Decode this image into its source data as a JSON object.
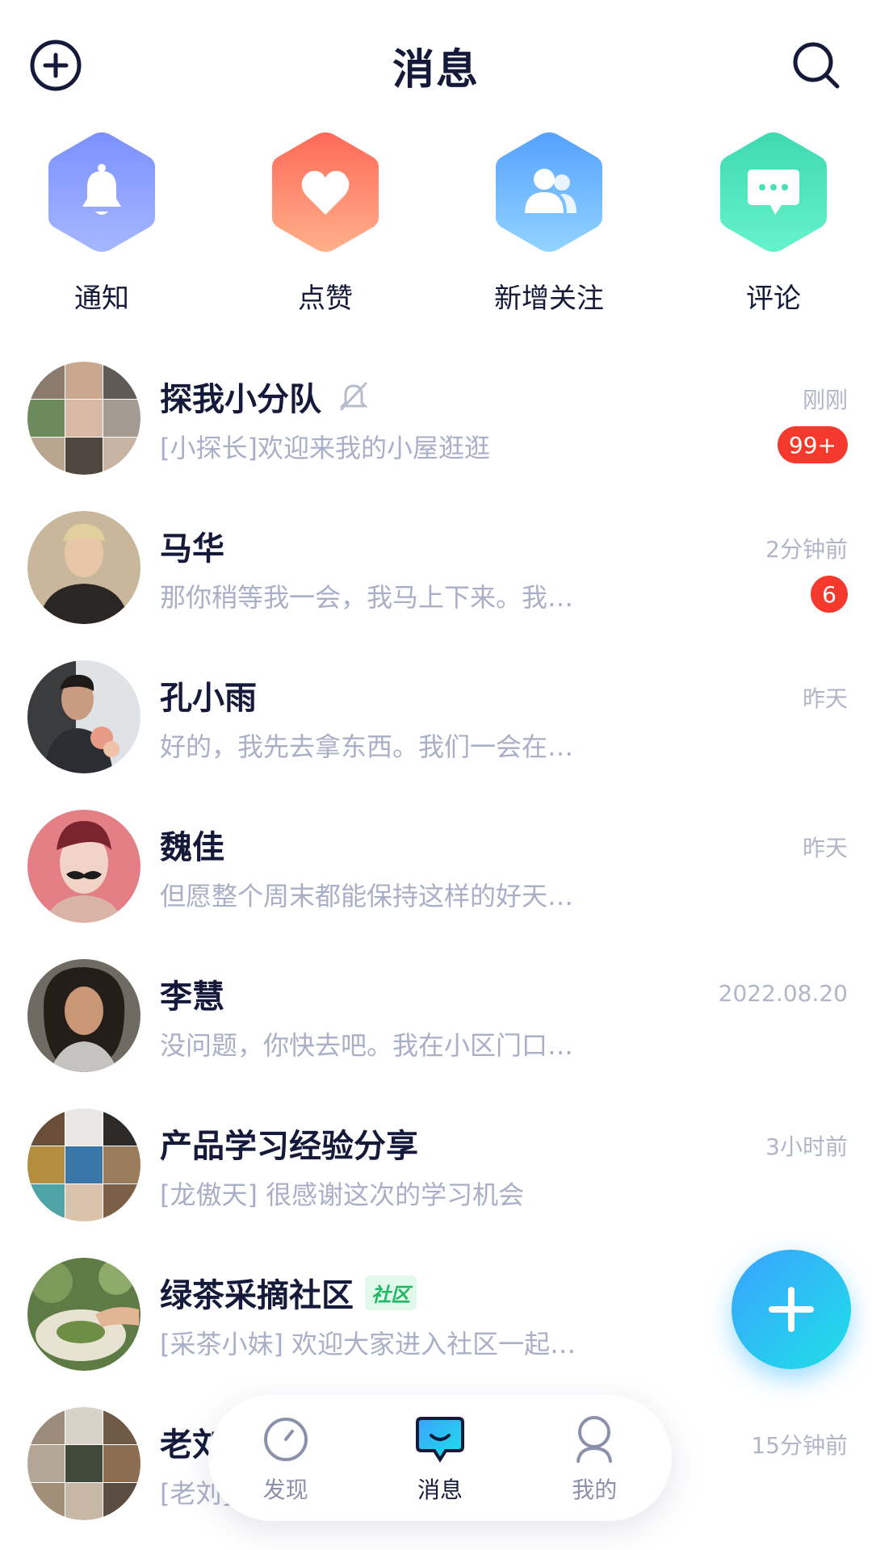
{
  "header": {
    "title": "消息",
    "add_icon": "plus-circle-icon",
    "search_icon": "search-icon"
  },
  "shortcuts": [
    {
      "label": "通知",
      "icon": "bell-icon",
      "colors": [
        "#7c90ff",
        "#9db2ff"
      ]
    },
    {
      "label": "点赞",
      "icon": "heart-icon",
      "colors": [
        "#ff6f5b",
        "#ffa981"
      ]
    },
    {
      "label": "新增关注",
      "icon": "users-icon",
      "colors": [
        "#5aa6ff",
        "#8fd0ff"
      ]
    },
    {
      "label": "评论",
      "icon": "comment-icon",
      "colors": [
        "#3fe0b5",
        "#62f0c9"
      ]
    }
  ],
  "conversations": [
    {
      "name": "探我小分队",
      "preview": "[小探长]欢迎来我的小屋逛逛",
      "time": "刚刚",
      "badge": "99+",
      "muted": true
    },
    {
      "name": "马华",
      "preview": "那你稍等我一会，我马上下来。我…",
      "time": "2分钟前",
      "badge": "6"
    },
    {
      "name": "孔小雨",
      "preview": "好的，我先去拿东西。我们一会在…",
      "time": "昨天"
    },
    {
      "name": "魏佳",
      "preview": "但愿整个周末都能保持这样的好天…",
      "time": "昨天"
    },
    {
      "name": "李慧",
      "preview": "没问题，你快去吧。我在小区门口…",
      "time": "2022.08.20"
    },
    {
      "name": "产品学习经验分享",
      "preview": "[龙傲天] 很感谢这次的学习机会",
      "time": "3小时前"
    },
    {
      "name": "绿茶采摘社区",
      "tag": "社区",
      "preview": "[采茶小妹] 欢迎大家进入社区一起…",
      "time": ""
    },
    {
      "name": "老刘",
      "preview": "[老刘]",
      "time": "15分钟前"
    }
  ],
  "tabbar": {
    "tabs": [
      {
        "label": "发现",
        "icon": "compass-icon"
      },
      {
        "label": "消息",
        "icon": "chat-icon",
        "active": true
      },
      {
        "label": "我的",
        "icon": "person-icon"
      }
    ]
  },
  "fab": {
    "icon": "plus-icon"
  }
}
